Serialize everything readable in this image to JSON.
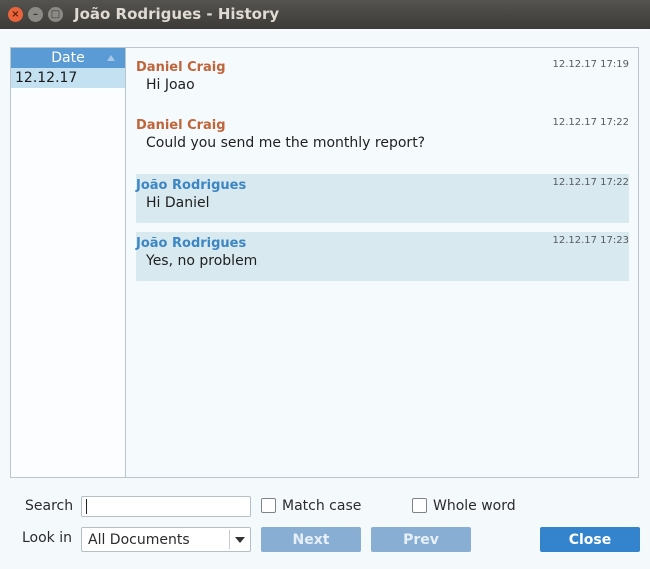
{
  "window": {
    "title": "João Rodrigues - History"
  },
  "date_list": {
    "header": "Date",
    "items": [
      "12.12.17"
    ]
  },
  "messages": [
    {
      "sender": "Daniel Craig",
      "time": "12.12.17 17:19",
      "text": "Hi Joao"
    },
    {
      "sender": "Daniel Craig",
      "time": "12.12.17 17:22",
      "text": "Could you send me the monthly report?"
    },
    {
      "sender": "João Rodrigues",
      "time": "12.12.17 17:22",
      "text": "Hi Daniel"
    },
    {
      "sender": "João Rodrigues",
      "time": "12.12.17 17:23",
      "text": "Yes, no problem"
    }
  ],
  "search": {
    "label": "Search",
    "value": "",
    "match_case_label": "Match case",
    "match_case_checked": false,
    "whole_word_label": "Whole word",
    "whole_word_checked": false
  },
  "look_in": {
    "label": "Look in",
    "selected": "All Documents"
  },
  "buttons": {
    "next": "Next",
    "prev": "Prev",
    "close": "Close"
  },
  "colors": {
    "accent": "#3484cd",
    "sender_other": "#c0643a",
    "sender_self": "#3d86c4",
    "selected_row": "#c4e1f2"
  },
  "icons": {
    "close": "close-icon",
    "minimize": "minimize-icon",
    "maximize": "maximize-icon",
    "sort": "sort-ascending-icon",
    "dropdown": "chevron-down-icon"
  }
}
